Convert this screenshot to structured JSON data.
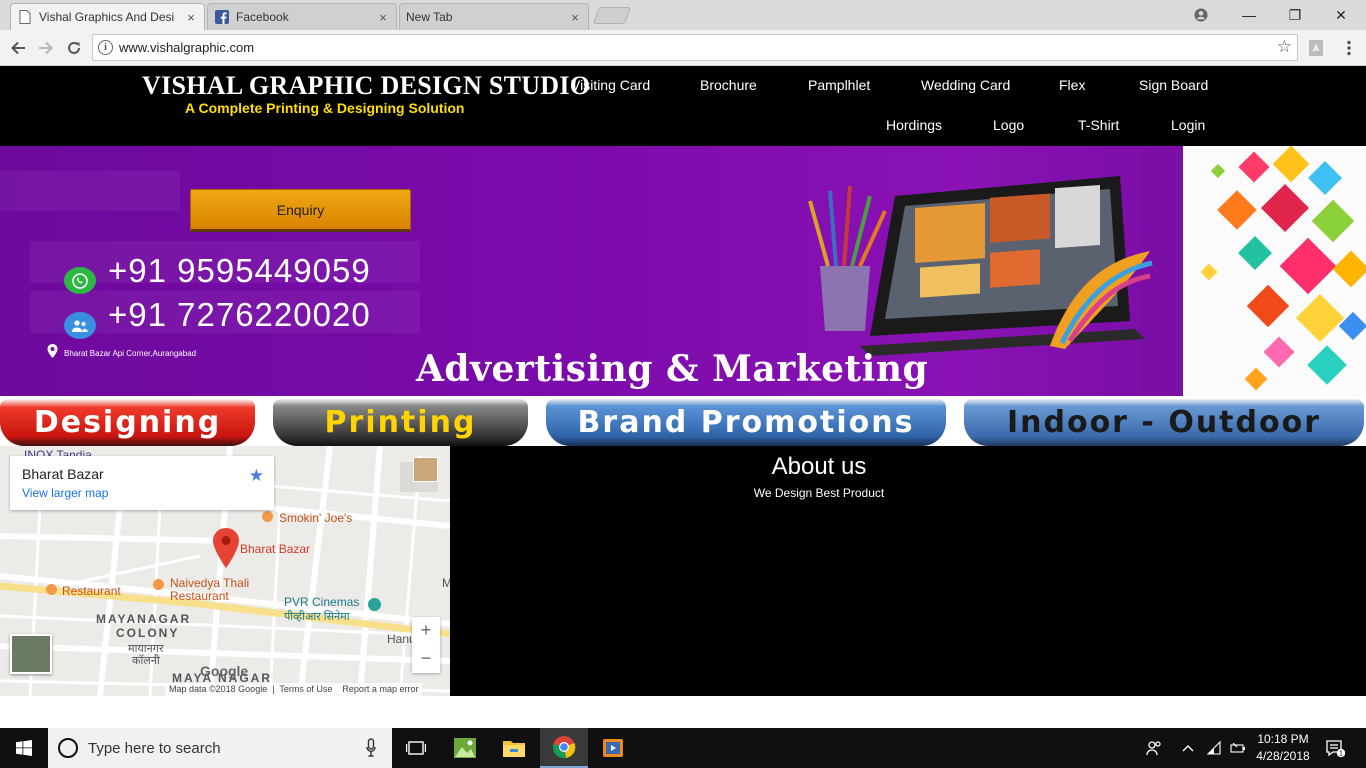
{
  "browser": {
    "tabs": [
      {
        "title": "Vishal Graphics And Desi",
        "close": "×"
      },
      {
        "title": "Facebook",
        "close": "×"
      },
      {
        "title": "New Tab",
        "close": "×"
      }
    ],
    "url": "www.vishalgraphic.com",
    "window_controls": {
      "minimize": "—",
      "maximize": "❐",
      "close": "✕"
    }
  },
  "header": {
    "title": "VISHAL GRAPHIC DESIGN STUDIO",
    "tagline": "A Complete Printing & Designing Solution",
    "nav": [
      "Visiting Card",
      "Brochure",
      "Pamplhlet",
      "Wedding Card",
      "Flex",
      "Sign Board",
      "Hordings",
      "Logo",
      "T-Shirt",
      "Login"
    ]
  },
  "banner": {
    "enquiry_label": "Enquiry",
    "phone1": "+91 9595449059",
    "phone2": "+91 7276220020",
    "address": "Bharat Bazar Api Corner,Aurangabad",
    "slogan": "Advertising & Marketing"
  },
  "services": [
    "Designing",
    "Printing",
    "Brand Promotions",
    "Indoor - Outdoor"
  ],
  "map": {
    "place": "Bharat Bazar",
    "view_larger": "View larger map",
    "labels": {
      "inox": "INOX Tandia",
      "smokin": "Smokin' Joe's",
      "pin": "Bharat Bazar",
      "restaurant": "Restaurant",
      "naivedya": "Naivedya Thali",
      "naivedya2": "Restaurant",
      "pvr": "PVR Cinemas",
      "pvr_hi": "पीव्हीआर सिनेमा",
      "mayanagar": "MAYANAGAR",
      "colony": "COLONY",
      "mayanagar_hi": "मायानगर",
      "colony_hi": "कॉलनी",
      "maya_nagar": "MAYA NAGAR",
      "han": "Hanu",
      "m": "M",
      "google": "Google"
    },
    "footer": {
      "data": "Map data ©2018 Google",
      "terms": "Terms of Use",
      "report": "Report a map error"
    },
    "zoom_in": "+",
    "zoom_out": "−"
  },
  "about": {
    "heading": "About us",
    "subtitle": "We Design Best Product"
  },
  "taskbar": {
    "search_placeholder": "Type here to search",
    "time": "10:18 PM",
    "date": "4/28/2018",
    "notifications": "1"
  },
  "colors": {
    "banner_purple": "#7b0aab",
    "tagline_yellow": "#ffde00",
    "enquiry_orange": "#e99a0c",
    "designing_red": "#e0241c",
    "brand_blue": "#3f77b7"
  }
}
